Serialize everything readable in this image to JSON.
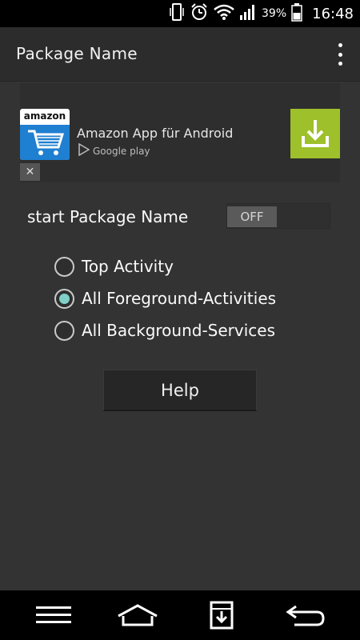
{
  "status_bar": {
    "battery_percent": "39%",
    "time": "16:48",
    "icons": [
      "phone-vibrate-icon",
      "alarm-icon",
      "wifi-icon",
      "signal-icon",
      "battery-icon"
    ]
  },
  "action_bar": {
    "title": "Package Name",
    "overflow_icon": "more-vert-icon"
  },
  "ad": {
    "app_brand": "amazon",
    "title": "Amazon App für Android",
    "store_label": "Google play",
    "close_symbol": "✕",
    "download_color": "#9ec02b"
  },
  "toggle": {
    "label": "start Package Name",
    "state": "OFF"
  },
  "radio_group": {
    "options": [
      {
        "label": "Top Activity",
        "checked": false
      },
      {
        "label": "All Foreground-Activities",
        "checked": true
      },
      {
        "label": "All Background-Services",
        "checked": false
      }
    ],
    "accent_color": "#7fd1c8"
  },
  "help_button": {
    "label": "Help"
  },
  "nav_bar": {
    "icons": [
      "menu-icon",
      "home-icon",
      "download-manager-icon",
      "back-icon"
    ]
  }
}
